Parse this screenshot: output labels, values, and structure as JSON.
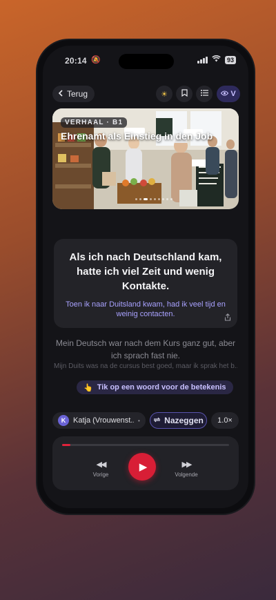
{
  "status_bar": {
    "time": "20:14",
    "battery": "93"
  },
  "topbar": {
    "back_label": "Terug",
    "eye_label": "V"
  },
  "hero": {
    "badge": "VERHAAL · B1",
    "title": "Ehrenamt als Einstieg in den Job"
  },
  "sentence_card": {
    "text": "Als ich nach Deutschland kam, hatte ich viel Zeit und wenig Kontakte.",
    "translation": "Toen ik naar Duitsland kwam, had ik veel tijd en weinig contacten."
  },
  "next_sentence": {
    "text": "Mein Deutsch war nach dem Kurs ganz gut, aber ich sprach fast nie.",
    "translation": "Mijn Duits was na de cursus best goed, maar ik sprak het b..."
  },
  "hint": {
    "emoji": "👆",
    "label": "Tik op een woord voor de betekenis"
  },
  "audio": {
    "voice_initial": "K",
    "voice_name": "Katja (Vrouwenst...",
    "replay_label": "Nazeggen",
    "speed": "1.0×",
    "progress": 0.05,
    "prev_label": "Vorige",
    "next_label": "Volgende"
  },
  "colors": {
    "accent": "#d81e36",
    "highlight": "#a9a2ff"
  }
}
